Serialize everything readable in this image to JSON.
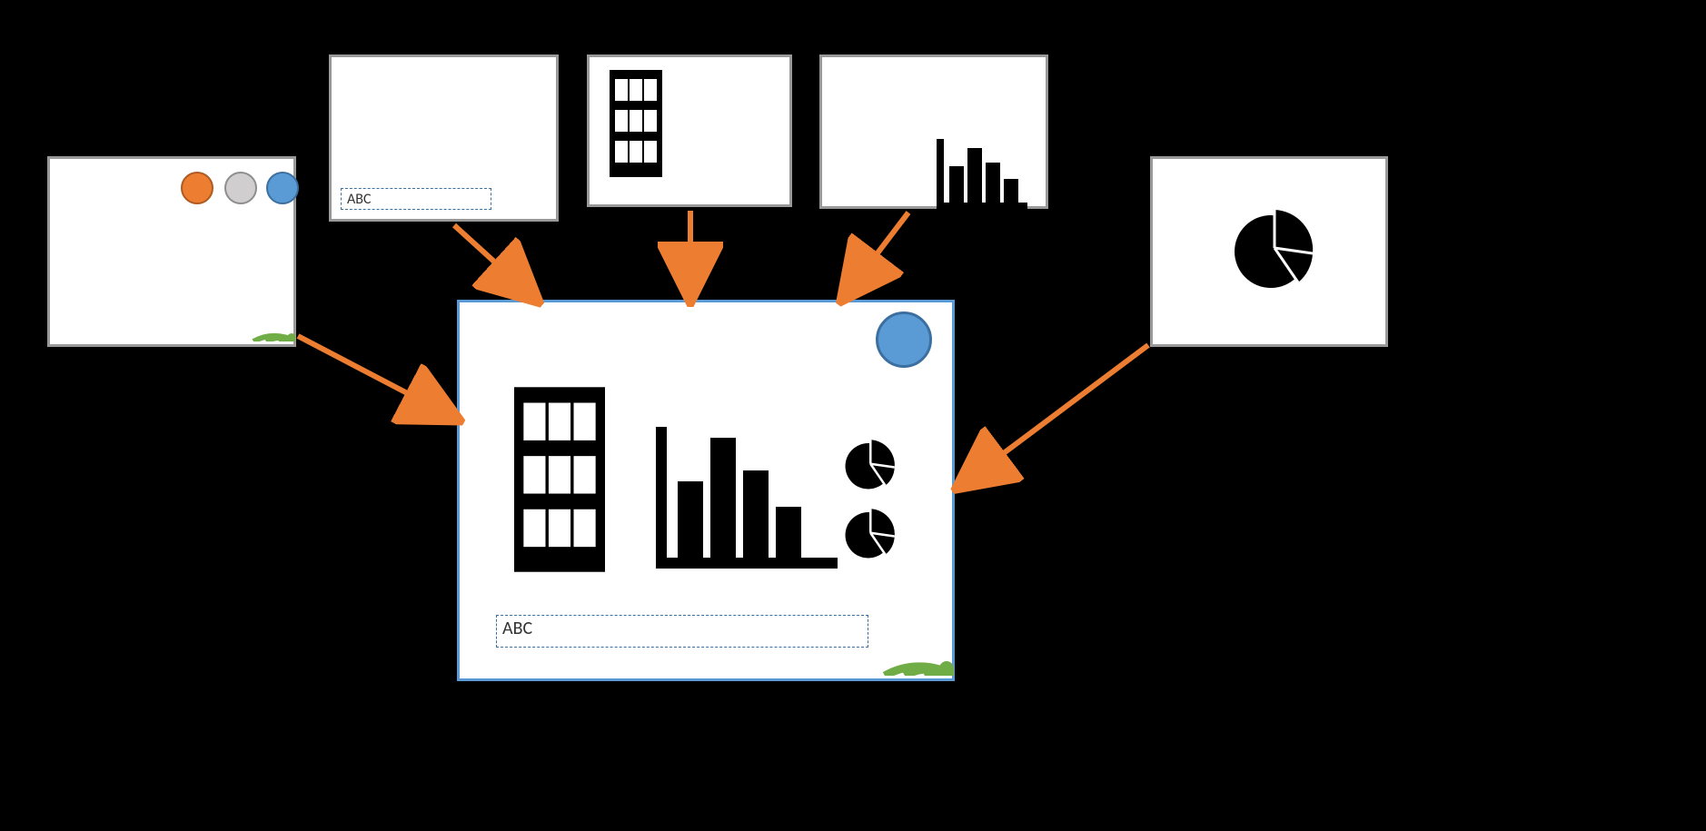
{
  "cards": {
    "card1": {
      "type": "colored-dots-card"
    },
    "card2": {
      "type": "text-placeholder-card",
      "placeholder": "ABC"
    },
    "card3": {
      "type": "building-card"
    },
    "card4": {
      "type": "bar-chart-card"
    },
    "card5": {
      "type": "pie-chart-card"
    },
    "main": {
      "type": "combined-card",
      "placeholder": "ABC"
    }
  },
  "colors": {
    "accent_orange": "#ed7d31",
    "accent_blue": "#5b9bd5",
    "accent_green": "#70ad47",
    "icon_black": "#000000"
  },
  "arrows": [
    {
      "from": "card1",
      "to": "main"
    },
    {
      "from": "card2",
      "to": "main"
    },
    {
      "from": "card3",
      "to": "main"
    },
    {
      "from": "card4",
      "to": "main"
    },
    {
      "from": "card5",
      "to": "main"
    }
  ]
}
